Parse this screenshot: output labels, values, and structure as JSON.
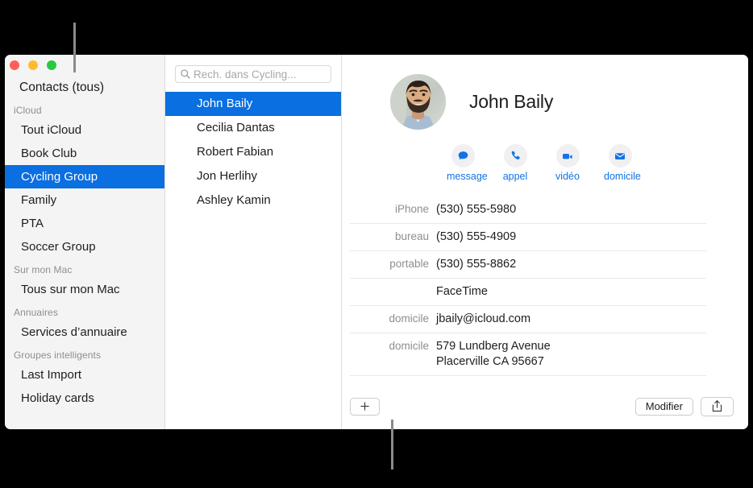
{
  "window": {
    "traffic_lights": [
      {
        "name": "close",
        "color": "#ff5f57"
      },
      {
        "name": "minimize",
        "color": "#febc2e"
      },
      {
        "name": "zoom",
        "color": "#28c840"
      }
    ]
  },
  "sidebar": {
    "top_item": "Contacts (tous)",
    "sections": [
      {
        "header": "iCloud",
        "items": [
          {
            "label": "Tout iCloud",
            "selected": false
          },
          {
            "label": "Book Club",
            "selected": false
          },
          {
            "label": "Cycling Group",
            "selected": true
          },
          {
            "label": "Family",
            "selected": false
          },
          {
            "label": "PTA",
            "selected": false
          },
          {
            "label": "Soccer Group",
            "selected": false
          }
        ]
      },
      {
        "header": "Sur mon Mac",
        "items": [
          {
            "label": "Tous sur mon Mac",
            "selected": false
          }
        ]
      },
      {
        "header": "Annuaires",
        "items": [
          {
            "label": "Services d’annuaire",
            "selected": false
          }
        ]
      },
      {
        "header": "Groupes intelligents",
        "items": [
          {
            "label": "Last Import",
            "selected": false
          },
          {
            "label": "Holiday cards",
            "selected": false
          }
        ]
      }
    ]
  },
  "search": {
    "icon": "search-icon",
    "placeholder": "Rech. dans Cycling...",
    "value": ""
  },
  "contact_list": {
    "items": [
      {
        "name": "John Baily",
        "selected": true
      },
      {
        "name": "Cecilia Dantas",
        "selected": false
      },
      {
        "name": "Robert Fabian",
        "selected": false
      },
      {
        "name": "Jon Herlihy",
        "selected": false
      },
      {
        "name": "Ashley Kamin",
        "selected": false
      }
    ]
  },
  "detail": {
    "avatar_alt": "contact-photo",
    "name": "John Baily",
    "accent_color": "#1273e6",
    "actions": [
      {
        "icon": "message-bubble-icon",
        "label": "message"
      },
      {
        "icon": "phone-icon",
        "label": "appel"
      },
      {
        "icon": "video-camera-icon",
        "label": "vidéo"
      },
      {
        "icon": "envelope-icon",
        "label": "domicile"
      }
    ],
    "fields": [
      {
        "label": "iPhone",
        "value": "(530) 555-5980",
        "rule": true
      },
      {
        "label": "bureau",
        "value": "(530) 555-4909",
        "rule": true
      },
      {
        "label": "portable",
        "value": "(530) 555-8862",
        "rule": true
      },
      {
        "label": "",
        "value": "FaceTime",
        "rule": true
      },
      {
        "label": "domicile",
        "value": "jbaily@icloud.com",
        "rule": true
      },
      {
        "label": "domicile",
        "value": "579 Lundberg Avenue\nPlacerville CA 95667",
        "rule": true
      }
    ]
  },
  "bottom_bar": {
    "add_label": "+",
    "add_icon": "plus-icon",
    "edit_label": "Modifier",
    "share_icon": "share-icon"
  }
}
